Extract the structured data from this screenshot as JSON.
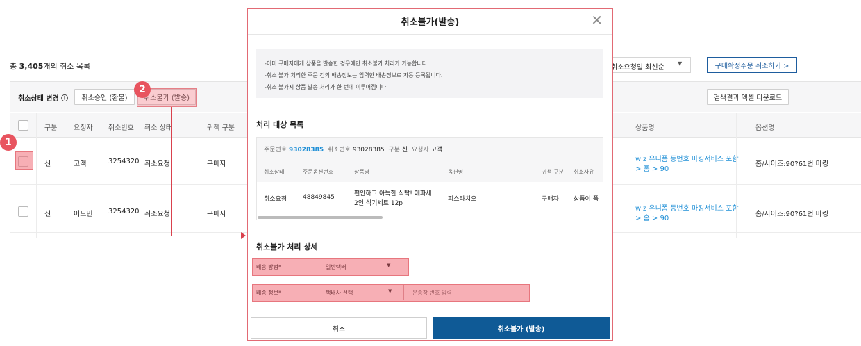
{
  "page": {
    "count_prefix": "총",
    "count_value": "3,405",
    "count_suffix": "개의 취소 목록",
    "sort_label": "취소요청일 최신순",
    "confirm_order_cancel_button": "구매확정주문 취소하기 >",
    "excel_button": "검색결과 엑셀 다운로드"
  },
  "toolbar": {
    "status_change_label": "취소상태 변경 ⓘ",
    "approve_button": "취소승인 (환불)",
    "reject_button": "취소불가 (발송)"
  },
  "table": {
    "headers": [
      "구분",
      "요청자",
      "취소번호",
      "취소 상태",
      "귀책 구분",
      "상품명",
      "옵션명"
    ],
    "rows": [
      {
        "type": "신",
        "requester": "고객",
        "cancel_no": "3254320",
        "status": "취소요청",
        "fault": "구매자",
        "product_a": "wiz 유니폼 등번호 마킹서비스 포함",
        "product_b": "> 홈 > 90",
        "option": "홈/사이즈:90?61번 마킹"
      },
      {
        "type": "신",
        "requester": "어드민",
        "cancel_no": "3254320",
        "status": "취소요청",
        "fault": "구매자",
        "product_a": "wiz 유니폼 등번호 마킹서비스 포함",
        "product_b": "> 홈 > 90",
        "option": "홈/사이즈:90?61번 마킹"
      }
    ]
  },
  "badges": {
    "one": "1",
    "two": "2"
  },
  "modal": {
    "title": "취소불가(발송)",
    "notices": [
      "-이미 구매자에게 상품을 발송한 경우에만 취소불가 처리가 가능합니다.",
      "-취소 불가 처리한 주문 건의 배송정보는 입력한 배송정보로 자동 등록됩니다.",
      "-취소 불가시 상품 발송 처리가 한 번에 이루어집니다."
    ],
    "target_section_title": "처리 대상 목록",
    "meta": {
      "order_no_label": "주문번호",
      "order_no": "93028385",
      "cancel_no_label": "취소번호",
      "cancel_no": "93028385",
      "type_label": "구분",
      "type": "신",
      "requester_label": "요청자",
      "requester": "고객"
    },
    "inner_headers": [
      "취소상태",
      "주문옵션번호",
      "상품명",
      "옵션명",
      "귀책 구분",
      "취소사유"
    ],
    "inner_row": {
      "status": "취소요청",
      "option_no": "48849845",
      "product_a": "편안하고 아늑한 식탁! 에파세",
      "product_b": "2인 식기세트 12p",
      "option": "피스타치오",
      "fault": "구매자",
      "reason": "상품이 품"
    },
    "detail_section_title": "취소불가 처리 상세",
    "shipping_method_label": "배송 방법*",
    "shipping_method_value": "일반택배",
    "shipping_info_label": "배송 정보*",
    "courier_select": "택배사 선택",
    "tracking_placeholder": "운송장 번호 입력",
    "cancel_button": "취소",
    "submit_button": "취소불가 (발송)"
  }
}
